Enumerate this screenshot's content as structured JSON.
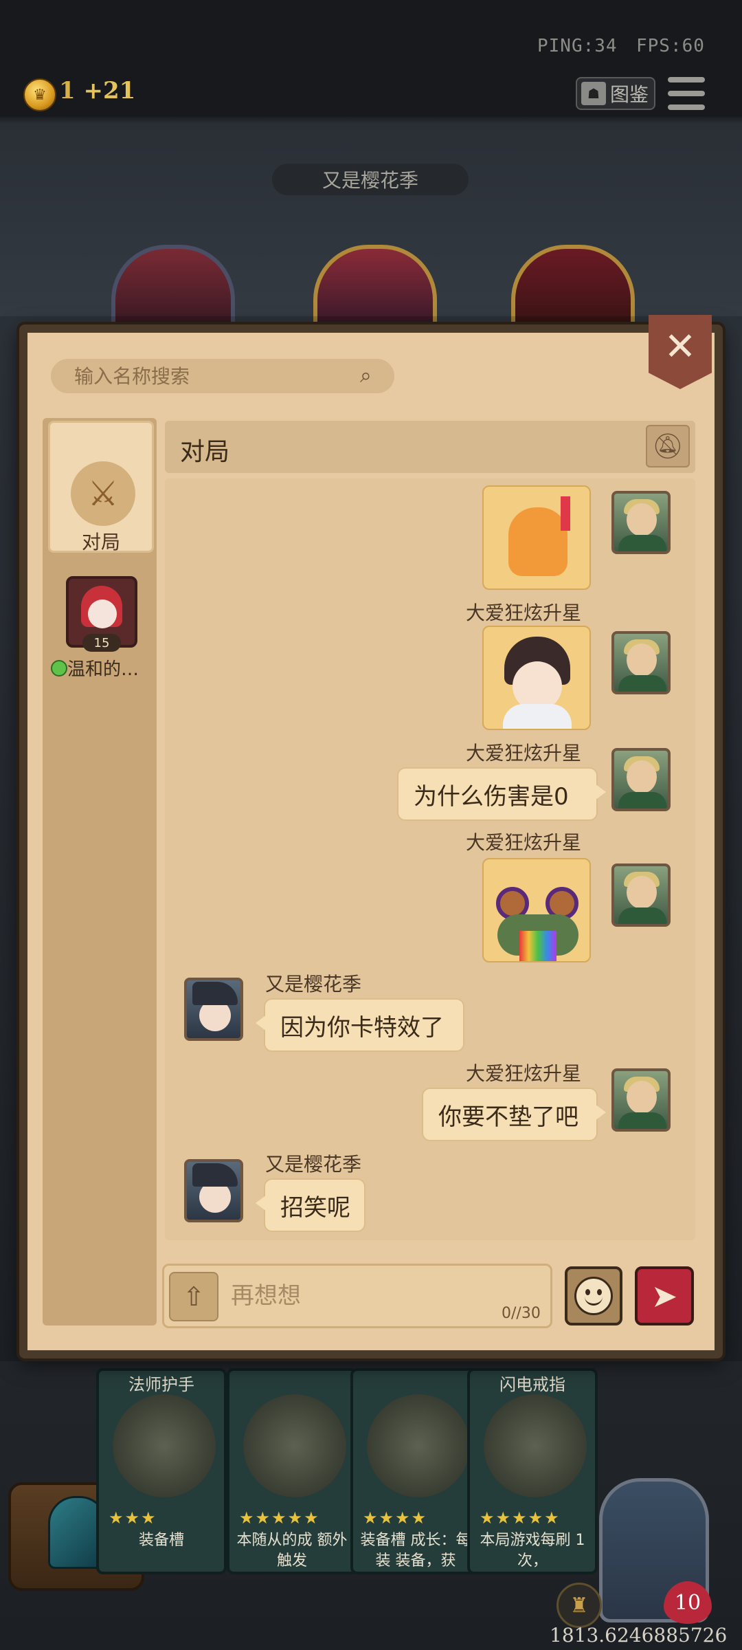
{
  "hud": {
    "ping": "PING:34",
    "fps": "FPS:60",
    "gold": "1",
    "gold_plus": "+21",
    "codex_label": "图鉴"
  },
  "battle": {
    "opponent_name": "又是樱花季"
  },
  "chat": {
    "search_placeholder": "输入名称搜索",
    "tab_match_label": "对局",
    "friend": {
      "level": "15",
      "name": "温和的…",
      "status": "online"
    },
    "header_title": "对局",
    "messages": [
      {
        "sender": "大爱狂炫升星",
        "type": "sticker",
        "side": "mine",
        "sticker": "fire-creature-sticker"
      },
      {
        "sender": "大爱狂炫升星",
        "type": "sticker",
        "side": "mine",
        "sticker": "girl-sticker"
      },
      {
        "sender": "大爱狂炫升星",
        "type": "text",
        "side": "mine",
        "text": "为什么伤害是0"
      },
      {
        "sender": "大爱狂炫升星",
        "type": "sticker",
        "side": "mine",
        "sticker": "frog-rainbow-sticker"
      },
      {
        "sender": "又是樱花季",
        "type": "text",
        "side": "theirs",
        "text": "因为你卡特效了"
      },
      {
        "sender": "大爱狂炫升星",
        "type": "text",
        "side": "mine",
        "text": "你要不垫了吧"
      },
      {
        "sender": "又是樱花季",
        "type": "text",
        "side": "theirs",
        "text": "招笑呢"
      }
    ],
    "input_placeholder": "再想想",
    "char_count": "0//30"
  },
  "shop": {
    "cards": [
      {
        "title": "法师护手",
        "desc": "装备槽"
      },
      {
        "title": "",
        "desc": "本随从的成 额外触发"
      },
      {
        "title": "",
        "desc": "装备槽 成长：每装 装备，获"
      },
      {
        "title": "闪电戒指",
        "desc": "本局游戏每刷 1次，"
      }
    ],
    "hero_hp": "10",
    "coords": "1813.6246885726"
  },
  "colors": {
    "panel": "#e7caa1",
    "bubble": "#f6dfb4",
    "send": "#b8283a",
    "close": "#8c4a3a",
    "online": "#5fc34a"
  }
}
